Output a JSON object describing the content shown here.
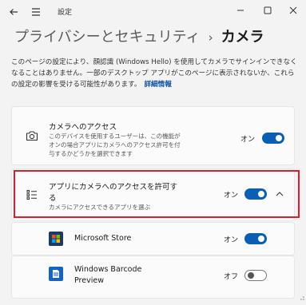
{
  "window": {
    "app_title": "設定",
    "back_icon": "back-arrow-icon",
    "menu_icon": "hamburger-menu-icon",
    "controls": [
      "minimize",
      "maximize",
      "close"
    ]
  },
  "header": {
    "parent": "プライバシーとセキュリティ",
    "separator": "›",
    "current": "カメラ"
  },
  "description": {
    "text": "このページの設定により、顔認識 (Windows Hello) を使用してカメラでサインインできなくなることはありません。一部のデスクトップ アプリがこのページに表示されないか、これらの設定の影響を受ける可能性があります。",
    "link": "詳細情報"
  },
  "camera_access": {
    "icon": "camera-icon",
    "title": "カメラへのアクセス",
    "subtitle_line1": "このデバイスを使用するユーザーは、この機能が",
    "subtitle_line2": "オンの場合アプリにカメラへのアクセス許可を付",
    "subtitle_line3": "与するかどうかを選択できます",
    "state": "オン",
    "on": true
  },
  "apps_access": {
    "icon": "app-list-icon",
    "title_line1": "アプリにカメラへのアクセスを許可す",
    "title_line2": "る",
    "subtitle": "カメラにアクセスできるアプリを選ぶ",
    "state": "オン",
    "on": true,
    "chevron": "chevron-up-icon"
  },
  "apps": [
    {
      "name_line1": "Microsoft Store",
      "name_line2": "",
      "icon": "microsoft-store-icon",
      "state": "オン",
      "on": true
    },
    {
      "name_line1": "Windows Barcode",
      "name_line2": "Preview",
      "icon": "barcode-preview-icon",
      "state": "オフ",
      "on": false
    }
  ],
  "colors": {
    "accent": "#0a5fb4",
    "highlight": "#e21b2a"
  }
}
